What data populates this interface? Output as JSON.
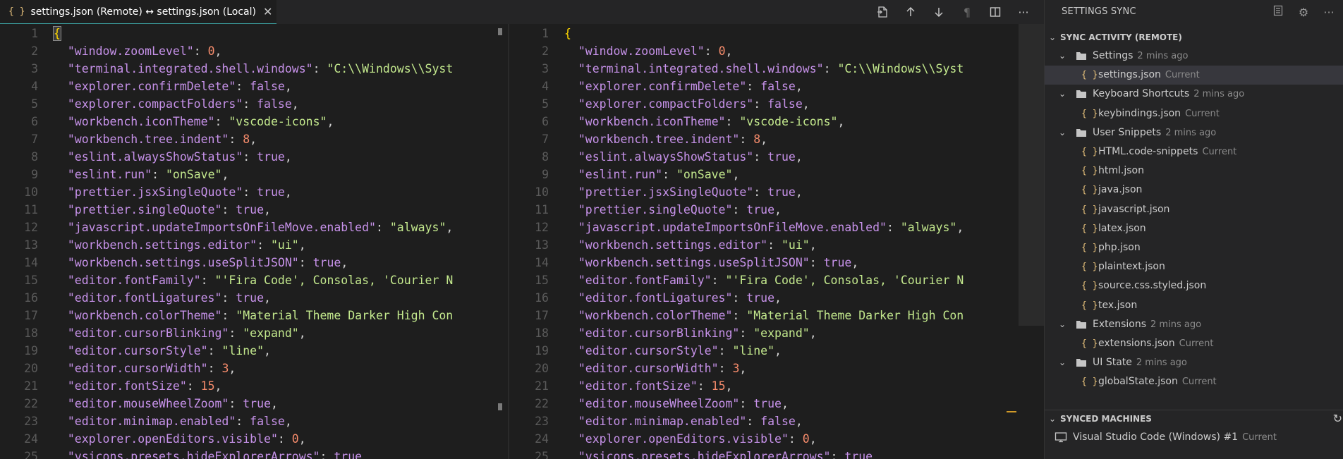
{
  "tab": {
    "icon": "{ }",
    "title": "settings.json (Remote) ↔ settings.json (Local)",
    "close": "✕"
  },
  "toolbar": {
    "open_file_icon": "open-file-icon",
    "prev_change_icon": "arrow-up-icon",
    "next_change_icon": "arrow-down-icon",
    "whitespace_icon": "pilcrow-icon",
    "split_icon": "split-editor-icon",
    "more_icon": "more-icon"
  },
  "editor": {
    "lines": [
      [
        [
          "brace",
          "{"
        ]
      ],
      [
        [
          "k",
          "\"window.zoomLevel\""
        ],
        [
          "p",
          ": "
        ],
        [
          "n",
          "0"
        ],
        [
          "p",
          ","
        ]
      ],
      [
        [
          "k",
          "\"terminal.integrated.shell.windows\""
        ],
        [
          "p",
          ": "
        ],
        [
          "s",
          "\"C:\\\\Windows\\\\Syst"
        ]
      ],
      [
        [
          "k",
          "\"explorer.confirmDelete\""
        ],
        [
          "p",
          ": "
        ],
        [
          "k",
          "false"
        ],
        [
          "p",
          ","
        ]
      ],
      [
        [
          "k",
          "\"explorer.compactFolders\""
        ],
        [
          "p",
          ": "
        ],
        [
          "k",
          "false"
        ],
        [
          "p",
          ","
        ]
      ],
      [
        [
          "k",
          "\"workbench.iconTheme\""
        ],
        [
          "p",
          ": "
        ],
        [
          "s",
          "\"vscode-icons\""
        ],
        [
          "p",
          ","
        ]
      ],
      [
        [
          "k",
          "\"workbench.tree.indent\""
        ],
        [
          "p",
          ": "
        ],
        [
          "n",
          "8"
        ],
        [
          "p",
          ","
        ]
      ],
      [
        [
          "k",
          "\"eslint.alwaysShowStatus\""
        ],
        [
          "p",
          ": "
        ],
        [
          "k",
          "true"
        ],
        [
          "p",
          ","
        ]
      ],
      [
        [
          "k",
          "\"eslint.run\""
        ],
        [
          "p",
          ": "
        ],
        [
          "s",
          "\"onSave\""
        ],
        [
          "p",
          ","
        ]
      ],
      [
        [
          "k",
          "\"prettier.jsxSingleQuote\""
        ],
        [
          "p",
          ": "
        ],
        [
          "k",
          "true"
        ],
        [
          "p",
          ","
        ]
      ],
      [
        [
          "k",
          "\"prettier.singleQuote\""
        ],
        [
          "p",
          ": "
        ],
        [
          "k",
          "true"
        ],
        [
          "p",
          ","
        ]
      ],
      [
        [
          "k",
          "\"javascript.updateImportsOnFileMove.enabled\""
        ],
        [
          "p",
          ": "
        ],
        [
          "s",
          "\"always\""
        ],
        [
          "p",
          ","
        ]
      ],
      [
        [
          "k",
          "\"workbench.settings.editor\""
        ],
        [
          "p",
          ": "
        ],
        [
          "s",
          "\"ui\""
        ],
        [
          "p",
          ","
        ]
      ],
      [
        [
          "k",
          "\"workbench.settings.useSplitJSON\""
        ],
        [
          "p",
          ": "
        ],
        [
          "k",
          "true"
        ],
        [
          "p",
          ","
        ]
      ],
      [
        [
          "k",
          "\"editor.fontFamily\""
        ],
        [
          "p",
          ": "
        ],
        [
          "s",
          "\"'Fira Code', Consolas, 'Courier N"
        ]
      ],
      [
        [
          "k",
          "\"editor.fontLigatures\""
        ],
        [
          "p",
          ": "
        ],
        [
          "k",
          "true"
        ],
        [
          "p",
          ","
        ]
      ],
      [
        [
          "k",
          "\"workbench.colorTheme\""
        ],
        [
          "p",
          ": "
        ],
        [
          "s",
          "\"Material Theme Darker High Con"
        ]
      ],
      [
        [
          "k",
          "\"editor.cursorBlinking\""
        ],
        [
          "p",
          ": "
        ],
        [
          "s",
          "\"expand\""
        ],
        [
          "p",
          ","
        ]
      ],
      [
        [
          "k",
          "\"editor.cursorStyle\""
        ],
        [
          "p",
          ": "
        ],
        [
          "s",
          "\"line\""
        ],
        [
          "p",
          ","
        ]
      ],
      [
        [
          "k",
          "\"editor.cursorWidth\""
        ],
        [
          "p",
          ": "
        ],
        [
          "n",
          "3"
        ],
        [
          "p",
          ","
        ]
      ],
      [
        [
          "k",
          "\"editor.fontSize\""
        ],
        [
          "p",
          ": "
        ],
        [
          "n",
          "15"
        ],
        [
          "p",
          ","
        ]
      ],
      [
        [
          "k",
          "\"editor.mouseWheelZoom\""
        ],
        [
          "p",
          ": "
        ],
        [
          "k",
          "true"
        ],
        [
          "p",
          ","
        ]
      ],
      [
        [
          "k",
          "\"editor.minimap.enabled\""
        ],
        [
          "p",
          ": "
        ],
        [
          "k",
          "false"
        ],
        [
          "p",
          ","
        ]
      ],
      [
        [
          "k",
          "\"explorer.openEditors.visible\""
        ],
        [
          "p",
          ": "
        ],
        [
          "n",
          "0"
        ],
        [
          "p",
          ","
        ]
      ],
      [
        [
          "k",
          "\"vsicons.presets.hideExplorerArrows\""
        ],
        [
          "p",
          ": "
        ],
        [
          "k",
          "true"
        ]
      ]
    ],
    "line_numbers": [
      "1",
      "2",
      "3",
      "4",
      "5",
      "6",
      "7",
      "8",
      "9",
      "10",
      "11",
      "12",
      "13",
      "14",
      "15",
      "16",
      "17",
      "18",
      "19",
      "20",
      "21",
      "22",
      "23",
      "24",
      "25"
    ]
  },
  "sidebar": {
    "title": "SETTINGS SYNC",
    "sync_activity_title": "SYNC ACTIVITY (REMOTE)",
    "groups": [
      {
        "label": "Settings",
        "time": "2 mins ago",
        "files": [
          {
            "name": "settings.json",
            "status": "Current"
          }
        ]
      },
      {
        "label": "Keyboard Shortcuts",
        "time": "2 mins ago",
        "files": [
          {
            "name": "keybindings.json",
            "status": "Current"
          }
        ]
      },
      {
        "label": "User Snippets",
        "time": "2 mins ago",
        "files": [
          {
            "name": "HTML.code-snippets",
            "status": "Current"
          },
          {
            "name": "html.json",
            "status": ""
          },
          {
            "name": "java.json",
            "status": ""
          },
          {
            "name": "javascript.json",
            "status": ""
          },
          {
            "name": "latex.json",
            "status": ""
          },
          {
            "name": "php.json",
            "status": ""
          },
          {
            "name": "plaintext.json",
            "status": ""
          },
          {
            "name": "source.css.styled.json",
            "status": ""
          },
          {
            "name": "tex.json",
            "status": ""
          }
        ]
      },
      {
        "label": "Extensions",
        "time": "2 mins ago",
        "files": [
          {
            "name": "extensions.json",
            "status": "Current"
          }
        ]
      },
      {
        "label": "UI State",
        "time": "2 mins ago",
        "files": [
          {
            "name": "globalState.json",
            "status": "Current"
          }
        ]
      }
    ],
    "synced_machines_title": "SYNCED MACHINES",
    "machine": {
      "name": "Visual Studio Code (Windows) #1",
      "status": "Current"
    }
  }
}
